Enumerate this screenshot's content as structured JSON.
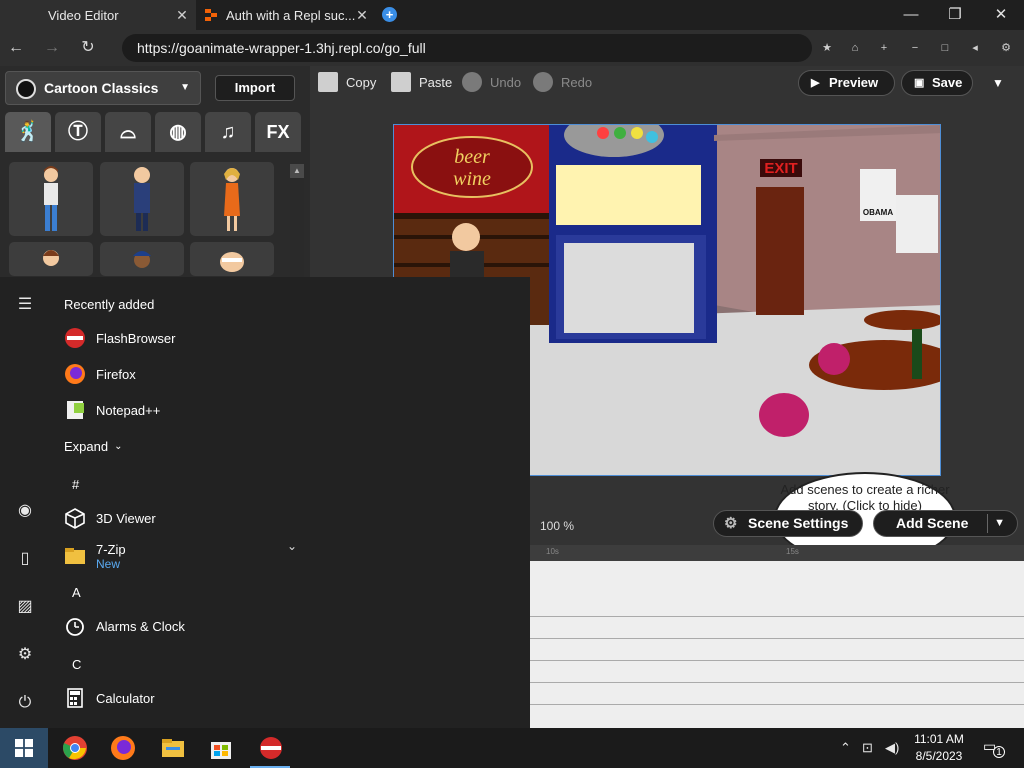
{
  "browser": {
    "tabs": [
      {
        "title": "Video Editor",
        "active": true
      },
      {
        "title": "Auth with a Repl suc...",
        "active": false
      }
    ],
    "url": "https://goanimate-wrapper-1.3hj.repl.co/go_full"
  },
  "editor": {
    "theme_label": "Cartoon Classics",
    "import_label": "Import",
    "fx_label": "FX",
    "toolbar": {
      "copy": "Copy",
      "paste": "Paste",
      "undo": "Undo",
      "redo": "Redo",
      "preview": "Preview",
      "save": "Save"
    },
    "stage": {
      "sign_beer": "beer",
      "sign_wine": "wine",
      "exit_sign": "EXIT",
      "poster_text": "OBAMA"
    },
    "hint_bubble": "Add scenes to create a richer story. (Click to hide)",
    "zoom": "100 %",
    "scene_settings": "Scene Settings",
    "add_scene": "Add Scene",
    "timeline_ruler": [
      "10s",
      "15s"
    ]
  },
  "start_menu": {
    "recently_added_label": "Recently added",
    "recent": [
      "FlashBrowser",
      "Firefox",
      "Notepad++"
    ],
    "expand_label": "Expand",
    "groups": [
      {
        "letter": "#",
        "apps": [
          {
            "name": "3D Viewer"
          },
          {
            "name": "7-Zip",
            "sub": "New"
          }
        ]
      },
      {
        "letter": "A",
        "apps": [
          {
            "name": "Alarms & Clock"
          }
        ]
      },
      {
        "letter": "C",
        "apps": [
          {
            "name": "Calculator"
          }
        ]
      }
    ]
  },
  "taskbar": {
    "time": "11:01 AM",
    "date": "8/5/2023",
    "notifications": "1"
  }
}
